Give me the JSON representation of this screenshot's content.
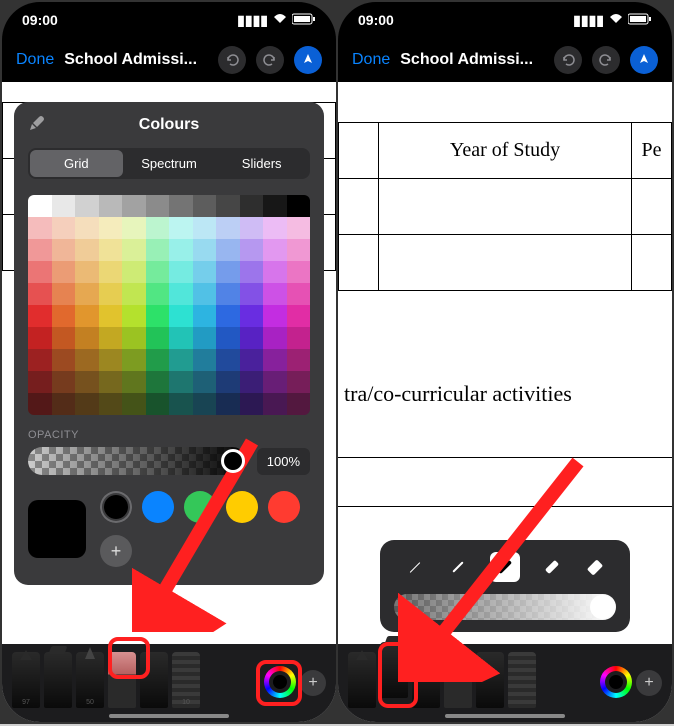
{
  "status": {
    "time": "09:00"
  },
  "toolbar": {
    "done": "Done",
    "title": "School Admissi..."
  },
  "colour_panel": {
    "title": "Colours",
    "tabs": {
      "grid": "Grid",
      "spectrum": "Spectrum",
      "sliders": "Sliders"
    },
    "opacity_label": "OPACITY",
    "opacity_value": "100%",
    "swatches": [
      "#000000",
      "#0a84ff",
      "#34c759",
      "#ffcc00",
      "#ff3b30"
    ]
  },
  "document": {
    "col1": "Year of Study",
    "col2_partial": "Pe",
    "body_text_partial": "tra/co-curricular activities"
  },
  "tool_numbers": {
    "pen": "97",
    "pencil": "50",
    "ruler": "10"
  }
}
